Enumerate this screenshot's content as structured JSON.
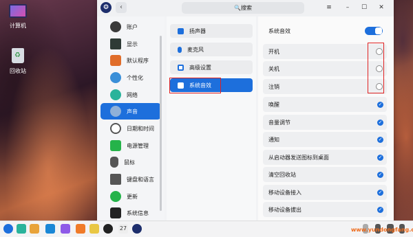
{
  "desktop": {
    "icons": [
      {
        "label": "计算机",
        "icon": "computer-icon"
      },
      {
        "label": "回收站",
        "icon": "trash-icon"
      }
    ]
  },
  "window": {
    "search_label": "🔍搜索",
    "buttons": [
      "≡",
      "–",
      "☐",
      "✕"
    ]
  },
  "sidebar": {
    "items": [
      {
        "label": "账户",
        "icon": "account-icon",
        "color": "#3b3b3b"
      },
      {
        "label": "显示",
        "icon": "display-icon",
        "color": "#2e3a36"
      },
      {
        "label": "默认程序",
        "icon": "default-apps-icon",
        "color": "#e06d2a"
      },
      {
        "label": "个性化",
        "icon": "personalization-icon",
        "color": "#3a8fd8"
      },
      {
        "label": "网络",
        "icon": "network-icon",
        "color": "#2ab39b"
      },
      {
        "label": "声音",
        "icon": "sound-icon",
        "color": "#8fb0d8",
        "active": true
      },
      {
        "label": "日期和时间",
        "icon": "clock-icon",
        "color": "#555555"
      },
      {
        "label": "电源管理",
        "icon": "power-icon",
        "color": "#25b34a"
      },
      {
        "label": "鼠标",
        "icon": "mouse-icon",
        "color": "#555555"
      },
      {
        "label": "键盘和语言",
        "icon": "keyboard-icon",
        "color": "#555555"
      },
      {
        "label": "更新",
        "icon": "update-icon",
        "color": "#25b34a"
      },
      {
        "label": "系统信息",
        "icon": "system-info-icon",
        "color": "#222222"
      }
    ]
  },
  "middle": {
    "items": [
      {
        "label": "扬声器",
        "icon": "speaker-icon"
      },
      {
        "label": "麦克风",
        "icon": "microphone-icon"
      },
      {
        "label": "高级设置",
        "icon": "advanced-settings-icon"
      },
      {
        "label": "系统音效",
        "icon": "system-sound-icon",
        "active": true
      }
    ]
  },
  "right": {
    "header_label": "系统音效",
    "header_toggle": "on",
    "rows": [
      {
        "label": "开机",
        "control": "radio"
      },
      {
        "label": "关机",
        "control": "radio"
      },
      {
        "label": "注销",
        "control": "radio"
      },
      {
        "label": "唤醒",
        "control": "check"
      },
      {
        "label": "音量调节",
        "control": "check"
      },
      {
        "label": "通知",
        "control": "check"
      },
      {
        "label": "从启动器发送图标到桌面",
        "control": "check"
      },
      {
        "label": "清空回收站",
        "control": "check"
      },
      {
        "label": "移动设备接入",
        "control": "check"
      },
      {
        "label": "移动设备拔出",
        "control": "check"
      }
    ]
  },
  "taskbar": {
    "watermark": "www.yundongfang.com",
    "badge": "27"
  },
  "colors": {
    "accent": "#1d6fdc",
    "highlight": "#e02020"
  }
}
